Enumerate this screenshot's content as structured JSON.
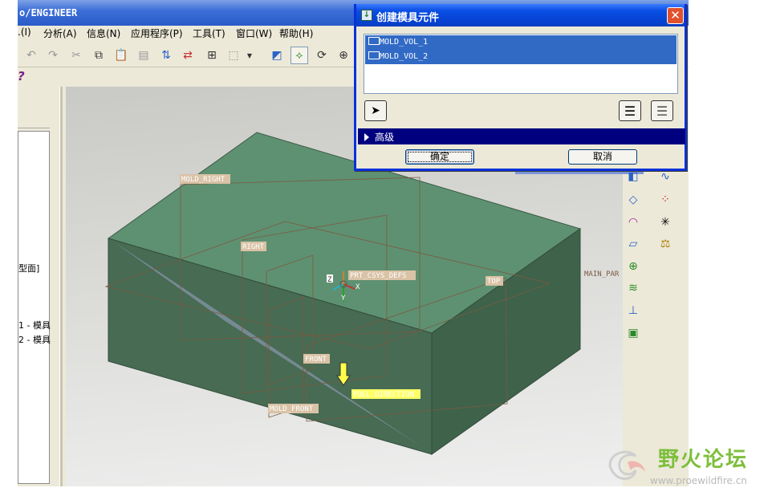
{
  "window": {
    "title": "o/ENGINEER"
  },
  "menubar": {
    "items": [
      ".(I)",
      "分析(A)",
      "信息(N)",
      "应用程序(P)",
      "工具(T)",
      "窗口(W)",
      "帮助(H)"
    ]
  },
  "model_tree": {
    "items": [
      "型面]",
      "1 - 模具",
      "2 - 模具"
    ]
  },
  "viewport": {
    "datum_labels": {
      "mold_right": "MOLD_RIGHT",
      "right": "RIGHT",
      "prt_csys": "PRT_CSYS_DEFS",
      "top": "TOP",
      "main_par": "MAIN_PAR",
      "front": "FRONT",
      "pull_direction": "PULL DIRECTION",
      "mold_front": "MOLD_FRONT",
      "axis_z": "Z",
      "axis_x": "X",
      "axis_y": "Y"
    },
    "colors": {
      "top_face": "#5e9171",
      "front_face": "#476b53",
      "side_face": "#3e624a",
      "datum_label_bg": "#d9c2a6",
      "pull_label_bg": "#ffff66"
    }
  },
  "dialog": {
    "title": "创建模具元件",
    "list_items": [
      "MOLD_VOL_1",
      "MOLD_VOL_2"
    ],
    "advanced_label": "高级",
    "ok_label": "确定",
    "cancel_label": "取消"
  },
  "watermark": {
    "title": "野火论坛",
    "url": "www.proewildfire.cn"
  },
  "icons": {
    "toolbar": [
      "undo-icon",
      "redo-icon",
      "cut-icon",
      "copy-icon",
      "paste-icon",
      "paste-special-icon",
      "regenerate-icon",
      "regenerate-manager-icon",
      "find-icon",
      "select-box-icon",
      "repaint-icon",
      "spin-center-icon",
      "orient-icon",
      "zoom-in-icon"
    ],
    "dialog": [
      "select-arrow-icon",
      "select-all-icon",
      "deselect-all-icon"
    ]
  }
}
